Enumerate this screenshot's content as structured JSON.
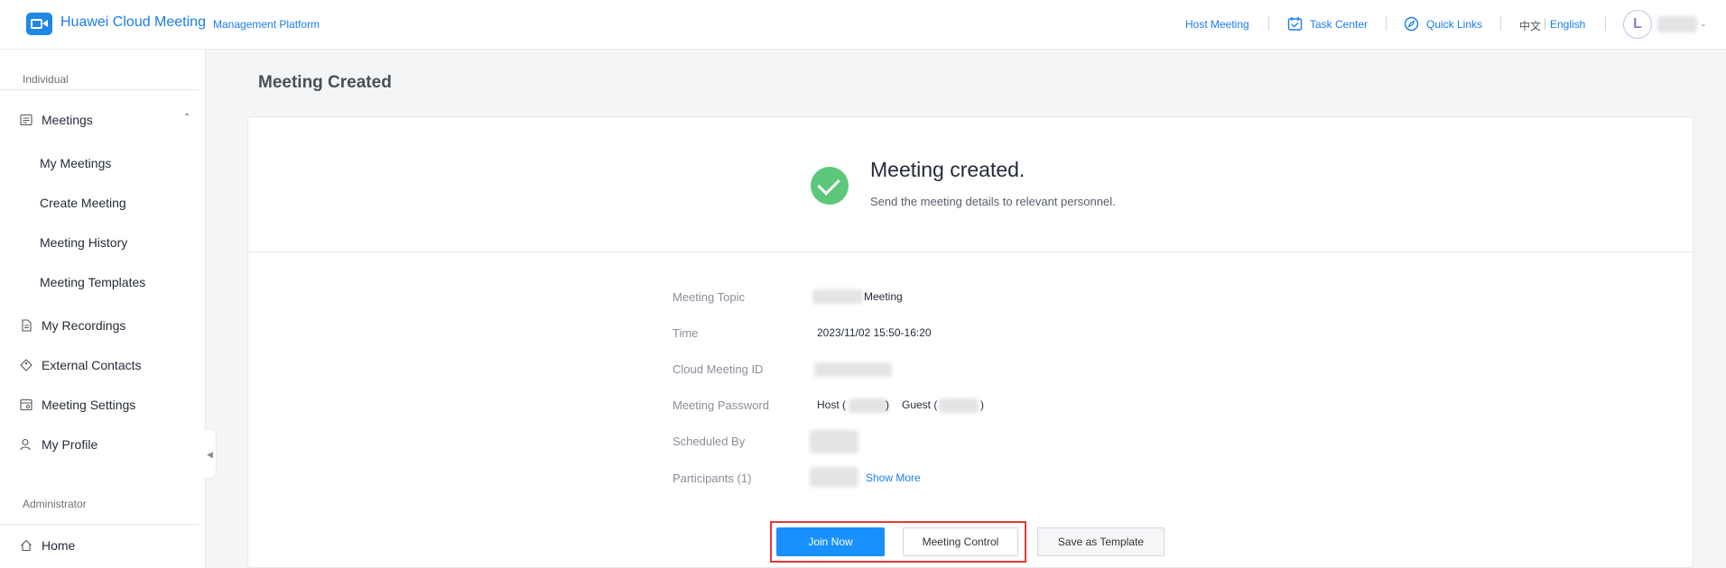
{
  "header": {
    "brand": "Huawei Cloud Meeting",
    "brand_sub": "Management Platform",
    "host_meeting": "Host Meeting",
    "task_center": "Task Center",
    "quick_links": "Quick Links",
    "lang_zh": "中文",
    "lang_en": "English",
    "avatar_letter": "L"
  },
  "sidebar": {
    "section_individual": "Individual",
    "meetings": "Meetings",
    "sub": [
      "My Meetings",
      "Create Meeting",
      "Meeting History",
      "Meeting Templates"
    ],
    "my_recordings": "My Recordings",
    "external_contacts": "External Contacts",
    "meeting_settings": "Meeting Settings",
    "my_profile": "My Profile",
    "section_admin": "Administrator",
    "home": "Home"
  },
  "main": {
    "page_title": "Meeting Created",
    "success_title": "Meeting created.",
    "success_desc": "Send the meeting details to relevant personnel.",
    "details": {
      "topic_label": "Meeting Topic",
      "topic_value": "Meeting",
      "time_label": "Time",
      "time_value": "2023/11/02 15:50-16:20",
      "id_label": "Cloud Meeting ID",
      "password_label": "Meeting Password",
      "host_label": "Host (",
      "host_close": ")",
      "guest_label": "Guest (",
      "guest_close": ")",
      "scheduled_label": "Scheduled By",
      "participants_label": "Participants (1)",
      "show_more": "Show More"
    },
    "buttons": {
      "join_now": "Join Now",
      "meeting_control": "Meeting Control",
      "save_template": "Save as Template"
    }
  },
  "colors": {
    "accent": "#1a7cf0",
    "primary_button": "#1890ff",
    "success": "#5cc779",
    "highlight": "#e53935"
  }
}
